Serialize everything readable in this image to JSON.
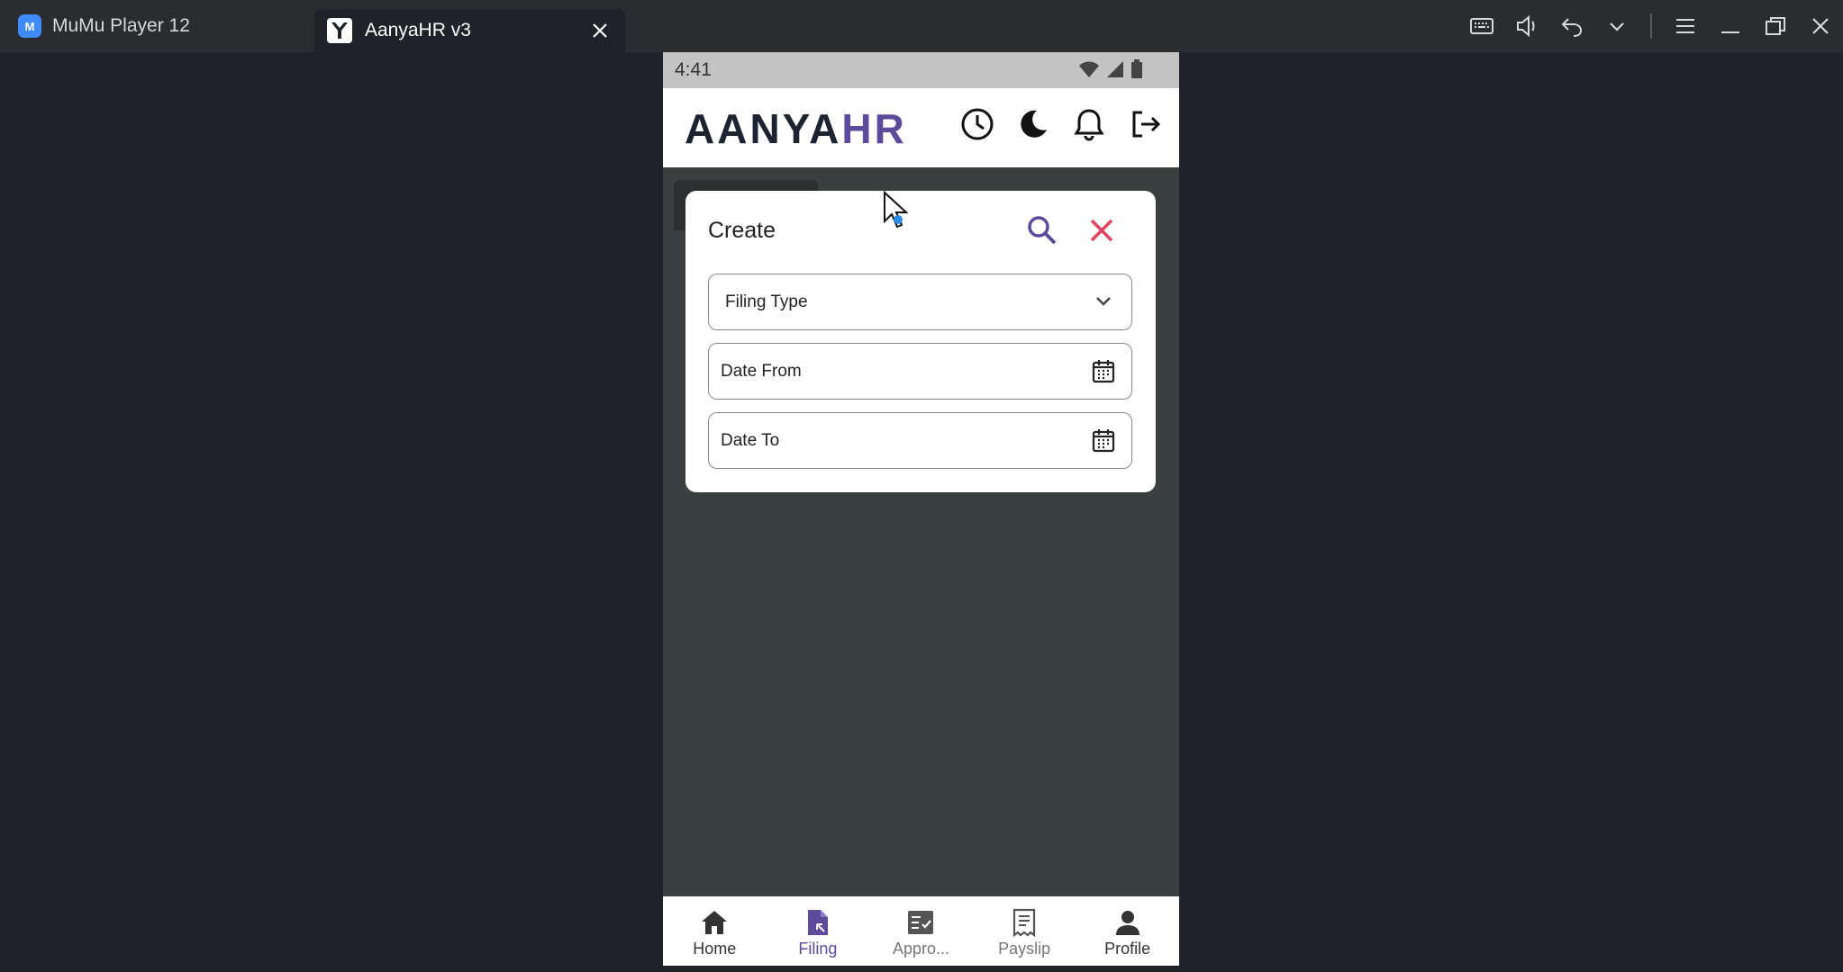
{
  "emulator": {
    "app_name": "MuMu Player 12",
    "active_tab_title": "AanyaHR v3"
  },
  "status_bar": {
    "time": "4:41"
  },
  "app_bar": {
    "logo_text_dark": "AANYA",
    "logo_text_accent": "HR",
    "icons": [
      "clock-icon",
      "dark-mode-icon",
      "bell-icon",
      "logout-icon"
    ]
  },
  "dialog": {
    "title": "Create",
    "filing_type_placeholder": "Filing Type",
    "date_from_placeholder": "Date From",
    "date_to_placeholder": "Date To"
  },
  "bottom_nav": {
    "items": [
      {
        "label": "Home",
        "icon": "home-icon"
      },
      {
        "label": "Filing",
        "icon": "filing-icon"
      },
      {
        "label": "Appro...",
        "icon": "approvals-icon"
      },
      {
        "label": "Payslip",
        "icon": "payslip-icon"
      },
      {
        "label": "Profile",
        "icon": "profile-icon"
      }
    ],
    "active": "Filing"
  },
  "colors": {
    "accent": "#5c4a9a",
    "close_red": "#e0435a",
    "background": "#1f2328",
    "phone_bg": "#3a3f3f"
  }
}
